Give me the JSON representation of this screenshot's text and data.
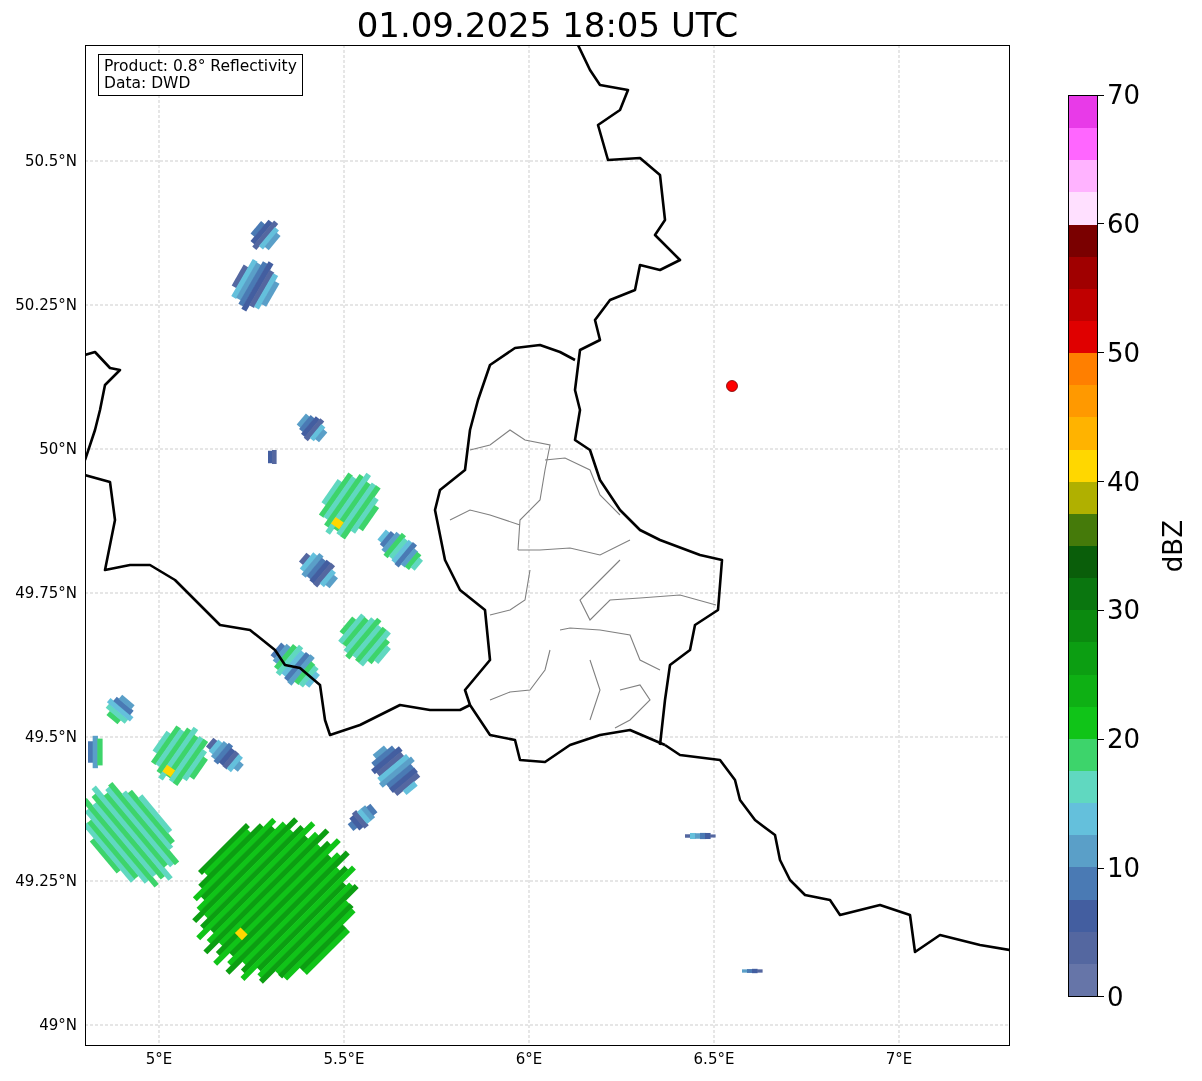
{
  "title": "01.09.2025 18:05 UTC",
  "info_box": {
    "lines": [
      "Product: 0.8° Reflectivity",
      "Data: DWD"
    ]
  },
  "map": {
    "y_labels": [
      "50.5°N",
      "50.25°N",
      "50°N",
      "49.75°N",
      "49.5°N",
      "49.25°N",
      "49°N"
    ],
    "x_labels": [
      "5°E",
      "5.5°E",
      "6°E",
      "6.5°E",
      "7°E"
    ]
  },
  "colorbar": {
    "label": "dBZ",
    "ticks": [
      "70",
      "60",
      "50",
      "40",
      "30",
      "20",
      "10",
      "0"
    ],
    "bands": [
      {
        "color": "#e83ae8"
      },
      {
        "color": "#ff66ff"
      },
      {
        "color": "#ffb3ff"
      },
      {
        "color": "#ffe0ff"
      },
      {
        "color": "#7a0000"
      },
      {
        "color": "#a00000"
      },
      {
        "color": "#c00000"
      },
      {
        "color": "#e00000"
      },
      {
        "color": "#ff7f00"
      },
      {
        "color": "#ff9900"
      },
      {
        "color": "#ffb300"
      },
      {
        "color": "#ffd700"
      },
      {
        "color": "#b0b000"
      },
      {
        "color": "#457a0a"
      },
      {
        "color": "#0a5e0a"
      },
      {
        "color": "#0a760f"
      },
      {
        "color": "#0b8a0f"
      },
      {
        "color": "#0c9e12"
      },
      {
        "color": "#0eb014"
      },
      {
        "color": "#10c418"
      },
      {
        "color": "#3dd46b"
      },
      {
        "color": "#60d8c0"
      },
      {
        "color": "#64c0dc"
      },
      {
        "color": "#5a9fc8"
      },
      {
        "color": "#4a7ab4"
      },
      {
        "color": "#435ea0"
      },
      {
        "color": "#5467a0"
      },
      {
        "color": "#6675a8"
      }
    ]
  }
}
